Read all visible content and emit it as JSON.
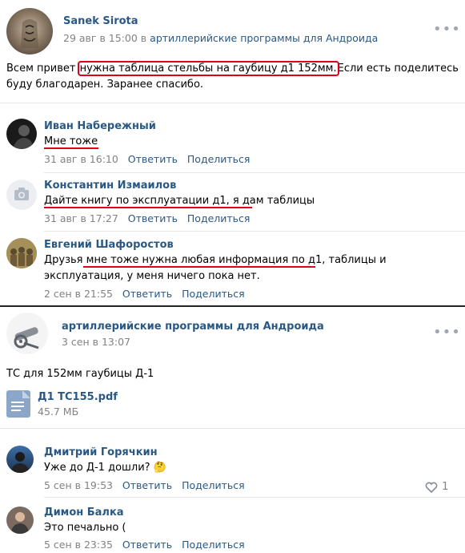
{
  "post1": {
    "author": "Sanek Sirota",
    "date": "29 авг в 15:00",
    "in_word": "в",
    "group": "артиллерийские программы для Андроида",
    "text_pre": "Всем привет ",
    "text_highlight": "нужна таблица стельбы на гаубицу д1 152мм.",
    "text_post_line1": "Если есть поделитесь",
    "text_line2": "буду благодарен. Заранее спасибо."
  },
  "comments1": [
    {
      "author": "Иван Набережный",
      "text": "Мне тоже",
      "date": "31 авг в 16:10",
      "reply": "Ответить",
      "share": "Поделиться"
    },
    {
      "author": "Константин Измаилов",
      "text": "Дайте книгу по эксплуатации д1, я дам таблицы",
      "date": "31 авг в 17:27",
      "reply": "Ответить",
      "share": "Поделиться"
    },
    {
      "author": "Евгений Шафоростов",
      "text_pre": "Друзья ",
      "text_mid": "мне тоже нужна любая информация по д1,",
      "text_post": " таблицы и",
      "text_line2": "эксплуатация, у меня ничего пока нет.",
      "date": "2 сен в 21:55",
      "reply": "Ответить",
      "share": "Поделиться"
    }
  ],
  "post2": {
    "author": "артиллерийские программы для Андроида",
    "date": "3 сен в 13:07",
    "text": "ТС для 152мм гаубицы Д-1",
    "file_name": "Д1 ТС155.pdf",
    "file_size": "45.7 МБ"
  },
  "comments2": [
    {
      "author": "Дмитрий Горячкин",
      "text": "Уже до Д-1 дошли?",
      "emoji": "🤔",
      "date": "5 сен в 19:53",
      "reply": "Ответить",
      "share": "Поделиться",
      "likes": "1"
    },
    {
      "author": "Димон Балка",
      "text": "Это печально (",
      "date": "5 сен в 23:35",
      "reply": "Ответить",
      "share": "Поделиться"
    }
  ],
  "colors": {
    "link": "#2a5885",
    "meta": "#828282",
    "highlight": "#e0001b",
    "separator": "#e7e8ec"
  },
  "icons": [
    "more-icon",
    "camera-icon",
    "document-icon",
    "heart-icon"
  ]
}
